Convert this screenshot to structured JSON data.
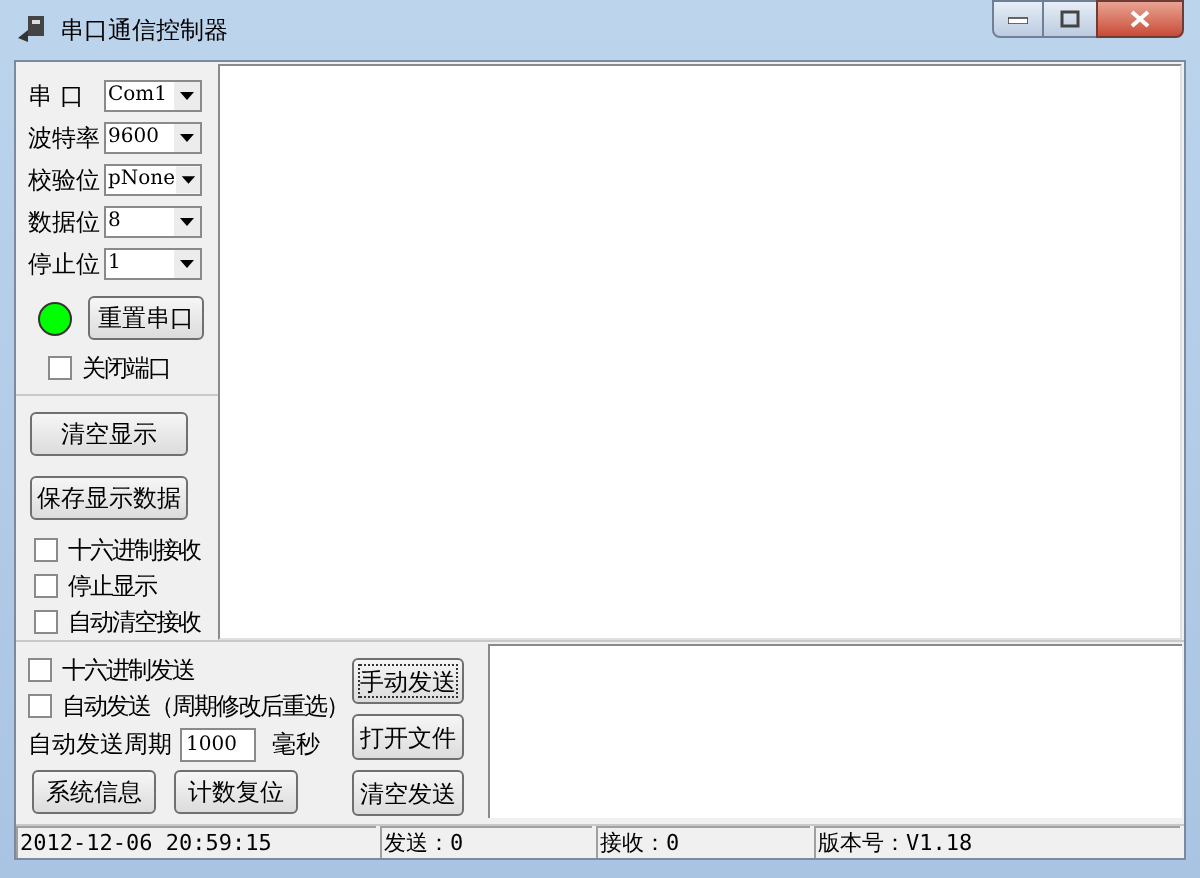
{
  "window": {
    "title": "串口通信控制器"
  },
  "serial_settings": [
    {
      "label": "串 口",
      "value": "Com1"
    },
    {
      "label": "波特率",
      "value": "9600"
    },
    {
      "label": "校验位",
      "value": "pNone"
    },
    {
      "label": "数据位",
      "value": "8"
    },
    {
      "label": "停止位",
      "value": "1"
    }
  ],
  "port_open": true,
  "reset_button": "重置串口",
  "close_port": {
    "label": "关闭端口",
    "checked": false
  },
  "display_buttons": [
    "清空显示",
    "保存显示数据"
  ],
  "receive_options": [
    {
      "label": "十六进制接收",
      "checked": false
    },
    {
      "label": "停止显示",
      "checked": false
    },
    {
      "label": "自动清空接收",
      "checked": false
    }
  ],
  "send_options": [
    {
      "label": "十六进制发送",
      "checked": false
    },
    {
      "label": "自动发送（周期修改后重选）",
      "checked": false
    }
  ],
  "period": {
    "label": "自动发送周期",
    "value": "1000",
    "unit": "毫秒"
  },
  "bottom_buttons": [
    "系统信息",
    "计数复位"
  ],
  "send_buttons": [
    {
      "label": "手动发送",
      "focused": true
    },
    {
      "label": "打开文件",
      "focused": false
    },
    {
      "label": "清空发送",
      "focused": false
    }
  ],
  "status_bar": [
    "2012-12-06 20:59:15",
    "发送：0",
    "接收：0",
    "版本号：V1.18"
  ]
}
